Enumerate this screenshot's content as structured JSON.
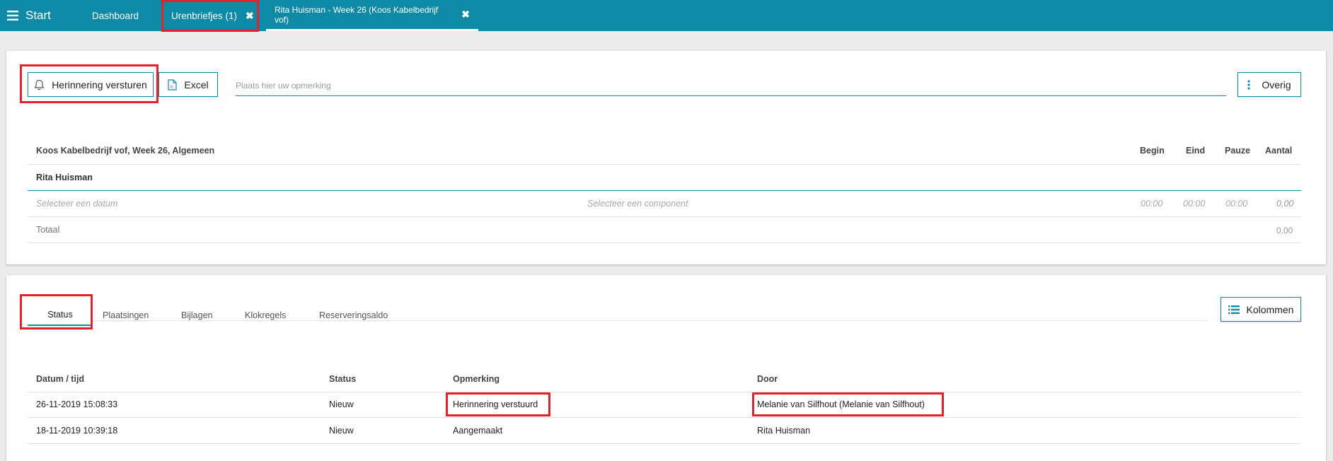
{
  "topbar": {
    "menu_label": "Start",
    "tabs": [
      {
        "label": "Dashboard"
      },
      {
        "label": "Urenbriefjes (1)",
        "close": "✖"
      },
      {
        "label": "Rita Huisman - Week 26 (Koos Kabelbedrijf vof)",
        "close": "✖"
      }
    ]
  },
  "toolbar": {
    "reminder_label": "Herinnering versturen",
    "excel_label": "Excel",
    "remark_placeholder": "Plaats hier uw opmerking",
    "more_label": "Overig"
  },
  "timesheet": {
    "title": "Koos Kabelbedrijf vof, Week 26, Algemeen",
    "columns": [
      "Begin",
      "Eind",
      "Pauze",
      "Aantal"
    ],
    "employee": "Rita Huisman",
    "entry": {
      "date_placeholder": "Selecteer een datum",
      "component_placeholder": "Selecteer een component",
      "begin": "00:00",
      "end": "00:00",
      "pause": "00:00",
      "amount": "0,00"
    },
    "total_label": "Totaal",
    "total_value": "0,00"
  },
  "history": {
    "tabs": [
      "Status",
      "Plaatsingen",
      "Bijlagen",
      "Klokregels",
      "Reserveringsaldo"
    ],
    "columns_button": "Kolommen",
    "headers": [
      "Datum / tijd",
      "Status",
      "Opmerking",
      "Door"
    ],
    "rows": [
      [
        "26-11-2019 15:08:33",
        "Nieuw",
        "Herinnering verstuurd",
        "Melanie van Silfhout (Melanie van Silfhout)"
      ],
      [
        "18-11-2019 10:39:18",
        "Nieuw",
        "Aangemaakt",
        "Rita Huisman"
      ]
    ]
  },
  "colors": {
    "accent": "#0e8aa6",
    "highlight": "#e3222e"
  }
}
